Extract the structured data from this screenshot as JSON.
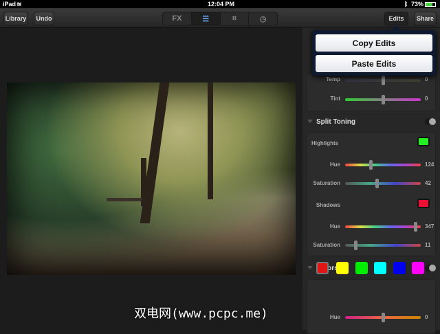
{
  "status": {
    "device": "iPad",
    "time": "12:04 PM",
    "battery": "73%"
  },
  "toolbar": {
    "library": "Library",
    "undo": "Undo",
    "edits": "Edits",
    "share": "Share",
    "tabs": [
      {
        "label": "FX",
        "icon": "fx-text"
      },
      {
        "label": "",
        "icon": "sliders-icon",
        "active": true
      },
      {
        "label": "",
        "icon": "crop-icon"
      },
      {
        "label": "",
        "icon": "clock-icon"
      }
    ]
  },
  "popover": {
    "copy": "Copy Edits",
    "paste": "Paste Edits"
  },
  "white_balance": {
    "temp": {
      "label": "Temp",
      "value": "0",
      "fraction": 0.5
    },
    "tint": {
      "label": "Tint",
      "value": "0",
      "fraction": 0.5
    }
  },
  "split_toning": {
    "title": "Split Toning",
    "highlights": {
      "label": "Highlights",
      "color": "#22ee22",
      "hue": {
        "label": "Hue",
        "value": "124",
        "fraction": 0.34
      },
      "saturation": {
        "label": "Saturation",
        "value": "42",
        "fraction": 0.42
      }
    },
    "shadows": {
      "label": "Shadows",
      "color": "#ee1133",
      "hue": {
        "label": "Hue",
        "value": "347",
        "fraction": 0.93
      },
      "saturation": {
        "label": "Saturation",
        "value": "11",
        "fraction": 0.14
      }
    }
  },
  "colors": {
    "title": "Colors",
    "swatches": [
      "#e01515",
      "#ffff00",
      "#00ee00",
      "#00ffff",
      "#0000ee",
      "#ff00ff"
    ],
    "hue": {
      "label": "Hue",
      "value": "0",
      "fraction": 0.5
    }
  },
  "watermark": "双电网(www.pcpc.me)"
}
